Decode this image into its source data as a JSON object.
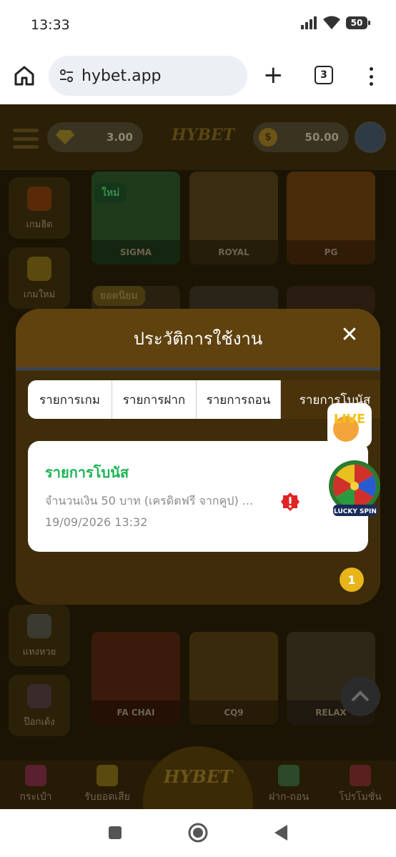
{
  "status_bar": {
    "time": "13:33",
    "battery": "50"
  },
  "browser": {
    "url": "hybet.app",
    "tab_count": "3"
  },
  "header": {
    "balance_credit": "3.00",
    "balance_coin": "50.00",
    "logo_text": "HYBET"
  },
  "sidebar": [
    {
      "label": "เกมฮิต",
      "icon": "fire-icon",
      "color": "#5a2a08"
    },
    {
      "label": "เกมใหม่",
      "icon": "new-badge-icon",
      "color": "#5a4a10"
    },
    {
      "label": "แทงหวย",
      "icon": "lottery-ticket-icon",
      "color": "#3a3a30"
    },
    {
      "label": "ป๊อกเด้ง",
      "icon": "playing-cards-icon",
      "color": "#3a2a2a"
    }
  ],
  "games": {
    "tag_new": "ใหม่",
    "tag_popular": "ยอดนิยม",
    "row1": [
      "SIGMA",
      "ROYAL",
      "PG"
    ],
    "row3": [
      "FA CHAI",
      "CQ9",
      "RELAX"
    ]
  },
  "bottom_nav": [
    {
      "label": "กระเป๋า",
      "icon": "wallet-icon"
    },
    {
      "label": "รับยอดเสีย",
      "icon": "cashback-icon"
    },
    {
      "label": "ฝาก-ถอน",
      "icon": "deposit-withdraw-icon"
    },
    {
      "label": "โปรโมชั่น",
      "icon": "gift-icon"
    }
  ],
  "modal": {
    "title": "ประวัติการใช้งาน",
    "tabs": [
      "รายการเกม",
      "รายการฝาก",
      "รายการถอน",
      "รายการโบนัส"
    ],
    "active_tab": 3,
    "record": {
      "title": "รายการโบนัส",
      "description": "จำนวนเงิน 50 บาท (เครดิตฟรี จากคูป) ...",
      "date": "19/09/2026 13:32"
    },
    "page_number": "1"
  },
  "floating": {
    "lucky_spin_label": "LUCKY SPIN",
    "live_label": "LIVE"
  },
  "colors": {
    "accent_green": "#1db455",
    "modal_brown": "#5f420e",
    "page_badge": "#e7b419"
  }
}
